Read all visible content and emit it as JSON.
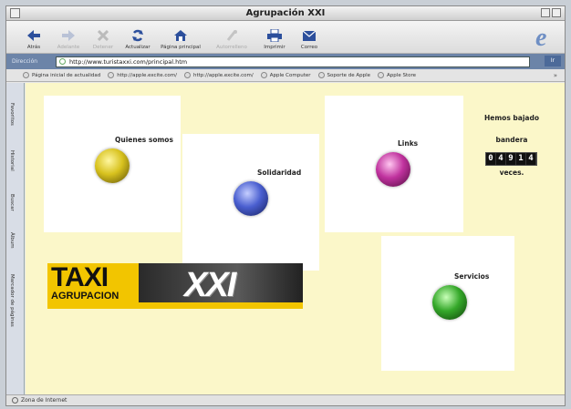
{
  "window": {
    "title": "Agrupación XXI"
  },
  "toolbar": {
    "buttons": [
      {
        "label": "Atrás",
        "icon": "back-arrow-icon",
        "enabled": true
      },
      {
        "label": "Adelante",
        "icon": "forward-arrow-icon",
        "enabled": false
      },
      {
        "label": "Detener",
        "icon": "stop-x-icon",
        "enabled": false
      },
      {
        "label": "Actualizar",
        "icon": "refresh-icon",
        "enabled": true
      },
      {
        "label": "Página principal",
        "icon": "home-icon",
        "enabled": true
      },
      {
        "label": "Autorrelleno",
        "icon": "autofill-icon",
        "enabled": false
      },
      {
        "label": "Imprimir",
        "icon": "print-icon",
        "enabled": true
      },
      {
        "label": "Correo",
        "icon": "mail-icon",
        "enabled": true
      }
    ]
  },
  "address": {
    "label": "Dirección",
    "url": "http://www.turistaxxi.com/principal.htm",
    "go": "Ir"
  },
  "links": [
    "Página inicial de actualidad",
    "http://apple.excite.com/",
    "http://apple.excite.com/",
    "Apple Computer",
    "Soporte de Apple",
    "Apple Store"
  ],
  "links_more": "»",
  "sidebar_tabs": [
    "Favoritos",
    "Historial",
    "Buscar",
    "Álbum",
    "Marcador de páginas"
  ],
  "page": {
    "cards": [
      {
        "label": "Quienes somos",
        "orb_color": "#d8c21e"
      },
      {
        "label": "Solidaridad",
        "orb_color": "#4a5fd0"
      },
      {
        "label": "Links",
        "orb_color": "#c0329e"
      },
      {
        "label": "Servicios",
        "orb_color": "#35a82a"
      }
    ],
    "counter": {
      "line1": "Hemos bajado",
      "line2": "bandera",
      "digits": [
        "0",
        "4",
        "9",
        "1",
        "4"
      ],
      "line3": "veces."
    },
    "banner": {
      "line1": "TAXI",
      "line2": "AGRUPACION",
      "line3": "XXI"
    }
  },
  "status": {
    "text": "Zona de Internet"
  },
  "colors": {
    "page_bg": "#fbf7c9",
    "address_bar": "#6c84a8"
  }
}
